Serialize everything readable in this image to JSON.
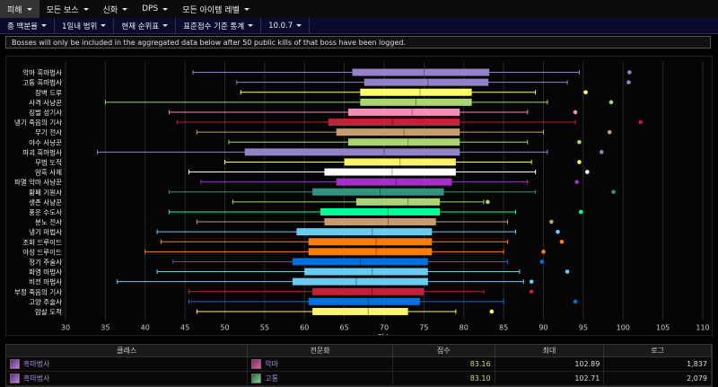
{
  "nav": {
    "items": [
      {
        "label": "피해"
      },
      {
        "label": "모든 보스"
      },
      {
        "label": "신화"
      },
      {
        "label": "DPS"
      },
      {
        "label": "모든 아이템 레벨"
      }
    ]
  },
  "subnav": {
    "items": [
      {
        "label": "종 백분율"
      },
      {
        "label": "1일내 범위"
      },
      {
        "label": "현재 순위표"
      },
      {
        "label": "표준점수 기준 통계"
      },
      {
        "label": "10.0.7"
      }
    ]
  },
  "notice": "Bosses will only be included in the aggregated data below after 50 public kills of that boss have been logged.",
  "chart_data": {
    "type": "boxplot",
    "orientation": "horizontal",
    "xlabel": "점수",
    "xlim": [
      30,
      110
    ],
    "xticks": [
      30,
      35,
      40,
      45,
      50,
      55,
      60,
      65,
      70,
      75,
      80,
      85,
      90,
      95,
      100,
      105,
      110
    ],
    "grid": true,
    "series": [
      {
        "name": "악마 흑마법사",
        "min": 46,
        "q1": 66,
        "median": 75,
        "q3": 83.2,
        "max": 94.5,
        "outlier": 100.8,
        "color": "#9482c9"
      },
      {
        "name": "고통 흑마법사",
        "min": 51.5,
        "q1": 67.5,
        "median": 75.5,
        "q3": 83.1,
        "max": 93,
        "outlier": 100.7,
        "color": "#9482c9"
      },
      {
        "name": "장벽 드루",
        "min": 52,
        "q1": 67,
        "median": 74.5,
        "q3": 81,
        "max": 89,
        "outlier": 95.3,
        "color": "#ffff68"
      },
      {
        "name": "사격 사냥꾼",
        "min": 35,
        "q1": 67,
        "median": 74,
        "q3": 81,
        "max": 90.5,
        "outlier": 98.5,
        "color": "#abd473"
      },
      {
        "name": "징벌 성기사",
        "min": 43,
        "q1": 65.5,
        "median": 73.5,
        "q3": 79.5,
        "max": 88,
        "outlier": 94,
        "color": "#f58cba"
      },
      {
        "name": "냉기 죽음의 기사",
        "min": 44,
        "q1": 63,
        "median": 71,
        "q3": 79.5,
        "max": 94,
        "outlier": 102.2,
        "color": "#c41f3b"
      },
      {
        "name": "무기 전사",
        "min": 46.5,
        "q1": 64,
        "median": 72.5,
        "q3": 79.5,
        "max": 90,
        "outlier": 98.3,
        "color": "#c79c6e"
      },
      {
        "name": "야수 사냥꾼",
        "min": 50.5,
        "q1": 65.5,
        "median": 73,
        "q3": 79.5,
        "max": 88,
        "outlier": 94.5,
        "color": "#abd473"
      },
      {
        "name": "파괴 흑마법사",
        "min": 34,
        "q1": 52.5,
        "median": 70,
        "q3": 79.5,
        "max": 90.5,
        "outlier": 97.3,
        "color": "#9482c9"
      },
      {
        "name": "무법 도적",
        "min": 50,
        "q1": 65,
        "median": 72,
        "q3": 79,
        "max": 88.5,
        "outlier": 94.5,
        "color": "#fff468"
      },
      {
        "name": "암흑 사제",
        "min": 45.5,
        "q1": 62.5,
        "median": 71,
        "q3": 79,
        "max": 89,
        "outlier": 95.5,
        "color": "#ffffff"
      },
      {
        "name": "파멸 악마 사냥꾼",
        "min": 47,
        "q1": 64,
        "median": 71.5,
        "q3": 78.5,
        "max": 88,
        "outlier": 94.2,
        "color": "#a330c9"
      },
      {
        "name": "황폐 기원사",
        "min": 43,
        "q1": 61,
        "median": 69.5,
        "q3": 77.5,
        "max": 89,
        "outlier": 98.8,
        "color": "#33937f"
      },
      {
        "name": "생존 사냥꾼",
        "min": 51,
        "q1": 66.5,
        "median": 73,
        "q3": 77,
        "max": 82.5,
        "outlier": 83,
        "color": "#abd473"
      },
      {
        "name": "풍운 수도사",
        "min": 43,
        "q1": 62,
        "median": 70.5,
        "q3": 77,
        "max": 86.5,
        "outlier": 94.7,
        "color": "#00ff96"
      },
      {
        "name": "분노 전사",
        "min": 46.5,
        "q1": 62.5,
        "median": 70.5,
        "q3": 76.5,
        "max": 85.5,
        "outlier": 91,
        "color": "#c79c6e"
      },
      {
        "name": "냉기 마법사",
        "min": 41.5,
        "q1": 59,
        "median": 68.5,
        "q3": 76,
        "max": 86.5,
        "outlier": 91.8,
        "color": "#69ccf0"
      },
      {
        "name": "조화 드루이드",
        "min": 42,
        "q1": 60.5,
        "median": 69,
        "q3": 76,
        "max": 85.5,
        "outlier": 92.3,
        "color": "#ff7d0a"
      },
      {
        "name": "야성 드루이드",
        "min": 40,
        "q1": 60.5,
        "median": 69,
        "q3": 76,
        "max": 85,
        "outlier": 90,
        "color": "#ff7d0a"
      },
      {
        "name": "정기 주술사",
        "min": 43.5,
        "q1": 58.5,
        "median": 67,
        "q3": 75.5,
        "max": 85.5,
        "outlier": 89.8,
        "color": "#0070de"
      },
      {
        "name": "화염 마법사",
        "min": 41.5,
        "q1": 60,
        "median": 68.5,
        "q3": 75.5,
        "max": 87,
        "outlier": 93,
        "color": "#69ccf0"
      },
      {
        "name": "비전 마법사",
        "min": 36.5,
        "q1": 58.5,
        "median": 66.5,
        "q3": 75.5,
        "max": 87.5,
        "outlier": 88.5,
        "color": "#69ccf0"
      },
      {
        "name": "부정 죽음의 기사",
        "min": 45.5,
        "q1": 61,
        "median": 68.5,
        "q3": 75,
        "max": 82.5,
        "outlier": 88.5,
        "color": "#c41f3b"
      },
      {
        "name": "고양 주술사",
        "min": 45.5,
        "q1": 60.5,
        "median": 68,
        "q3": 74.5,
        "max": 85,
        "outlier": 94,
        "color": "#0070de"
      },
      {
        "name": "암살 도적",
        "min": 46.5,
        "q1": 61,
        "median": 68,
        "q3": 73,
        "max": 79,
        "outlier": 83.5,
        "color": "#fff468"
      }
    ]
  },
  "table": {
    "headers": [
      "클래스",
      "전문화",
      "점수",
      "최대",
      "로그"
    ],
    "rows": [
      {
        "class": "흑마법사",
        "spec": "악마",
        "score": "83.16",
        "max": "102.89",
        "logs": "1,837",
        "spec_icon": "demonology-icon"
      },
      {
        "class": "흑마법사",
        "spec": "고통",
        "score": "83.10",
        "max": "102.71",
        "logs": "2,079",
        "spec_icon": "affliction-icon"
      }
    ]
  }
}
